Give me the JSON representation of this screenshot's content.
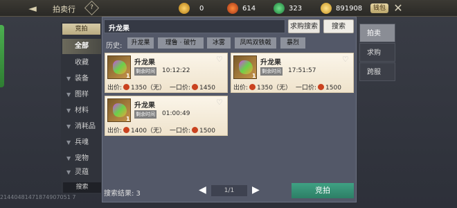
{
  "topbar": {
    "title": "拍卖行",
    "help": "?",
    "currency1": "0",
    "currency2": "614",
    "currency3": "323",
    "currency4": "891908",
    "wallet": "钱包"
  },
  "left_panel": {
    "header": "竞拍",
    "categories": [
      {
        "label": "全部",
        "active": true
      },
      {
        "label": "收藏"
      },
      {
        "label": "装备"
      },
      {
        "label": "图样"
      },
      {
        "label": "材料"
      },
      {
        "label": "消耗品"
      },
      {
        "label": "兵魂"
      },
      {
        "label": "宠物"
      },
      {
        "label": "灵蕴"
      }
    ],
    "search_label": "搜索"
  },
  "search": {
    "value": "升龙果",
    "buy_search": "求购搜索",
    "search_button": "搜索"
  },
  "history": {
    "label": "历史:",
    "tags": [
      "升龙果",
      "理鲁 · 破竹",
      "冰雾",
      "凤鸣双铁戟",
      "暴烈"
    ]
  },
  "items": [
    {
      "name": "升龙果",
      "qty": "1",
      "time_label": "剩余时间",
      "time": "10:12:22",
      "bid_label": "出价:",
      "bid": "1350（无）",
      "buy_label": "一口价:",
      "buy": "1450"
    },
    {
      "name": "升龙果",
      "qty": "1",
      "time_label": "剩余时间",
      "time": "17:51:57",
      "bid_label": "出价:",
      "bid": "1350（无）",
      "buy_label": "一口价:",
      "buy": "1500"
    },
    {
      "name": "升龙果",
      "qty": "1",
      "time_label": "剩余时间",
      "time": "01:00:49",
      "bid_label": "出价:",
      "bid": "1400（无）",
      "buy_label": "一口价:",
      "buy": "1500"
    }
  ],
  "bottom": {
    "results_label": "搜索结果: 3",
    "page": "1/1",
    "bid_button": "竞拍"
  },
  "right_tabs": [
    "拍卖",
    "求购",
    "跨服"
  ],
  "footer_id": "21440481471874907051 7"
}
